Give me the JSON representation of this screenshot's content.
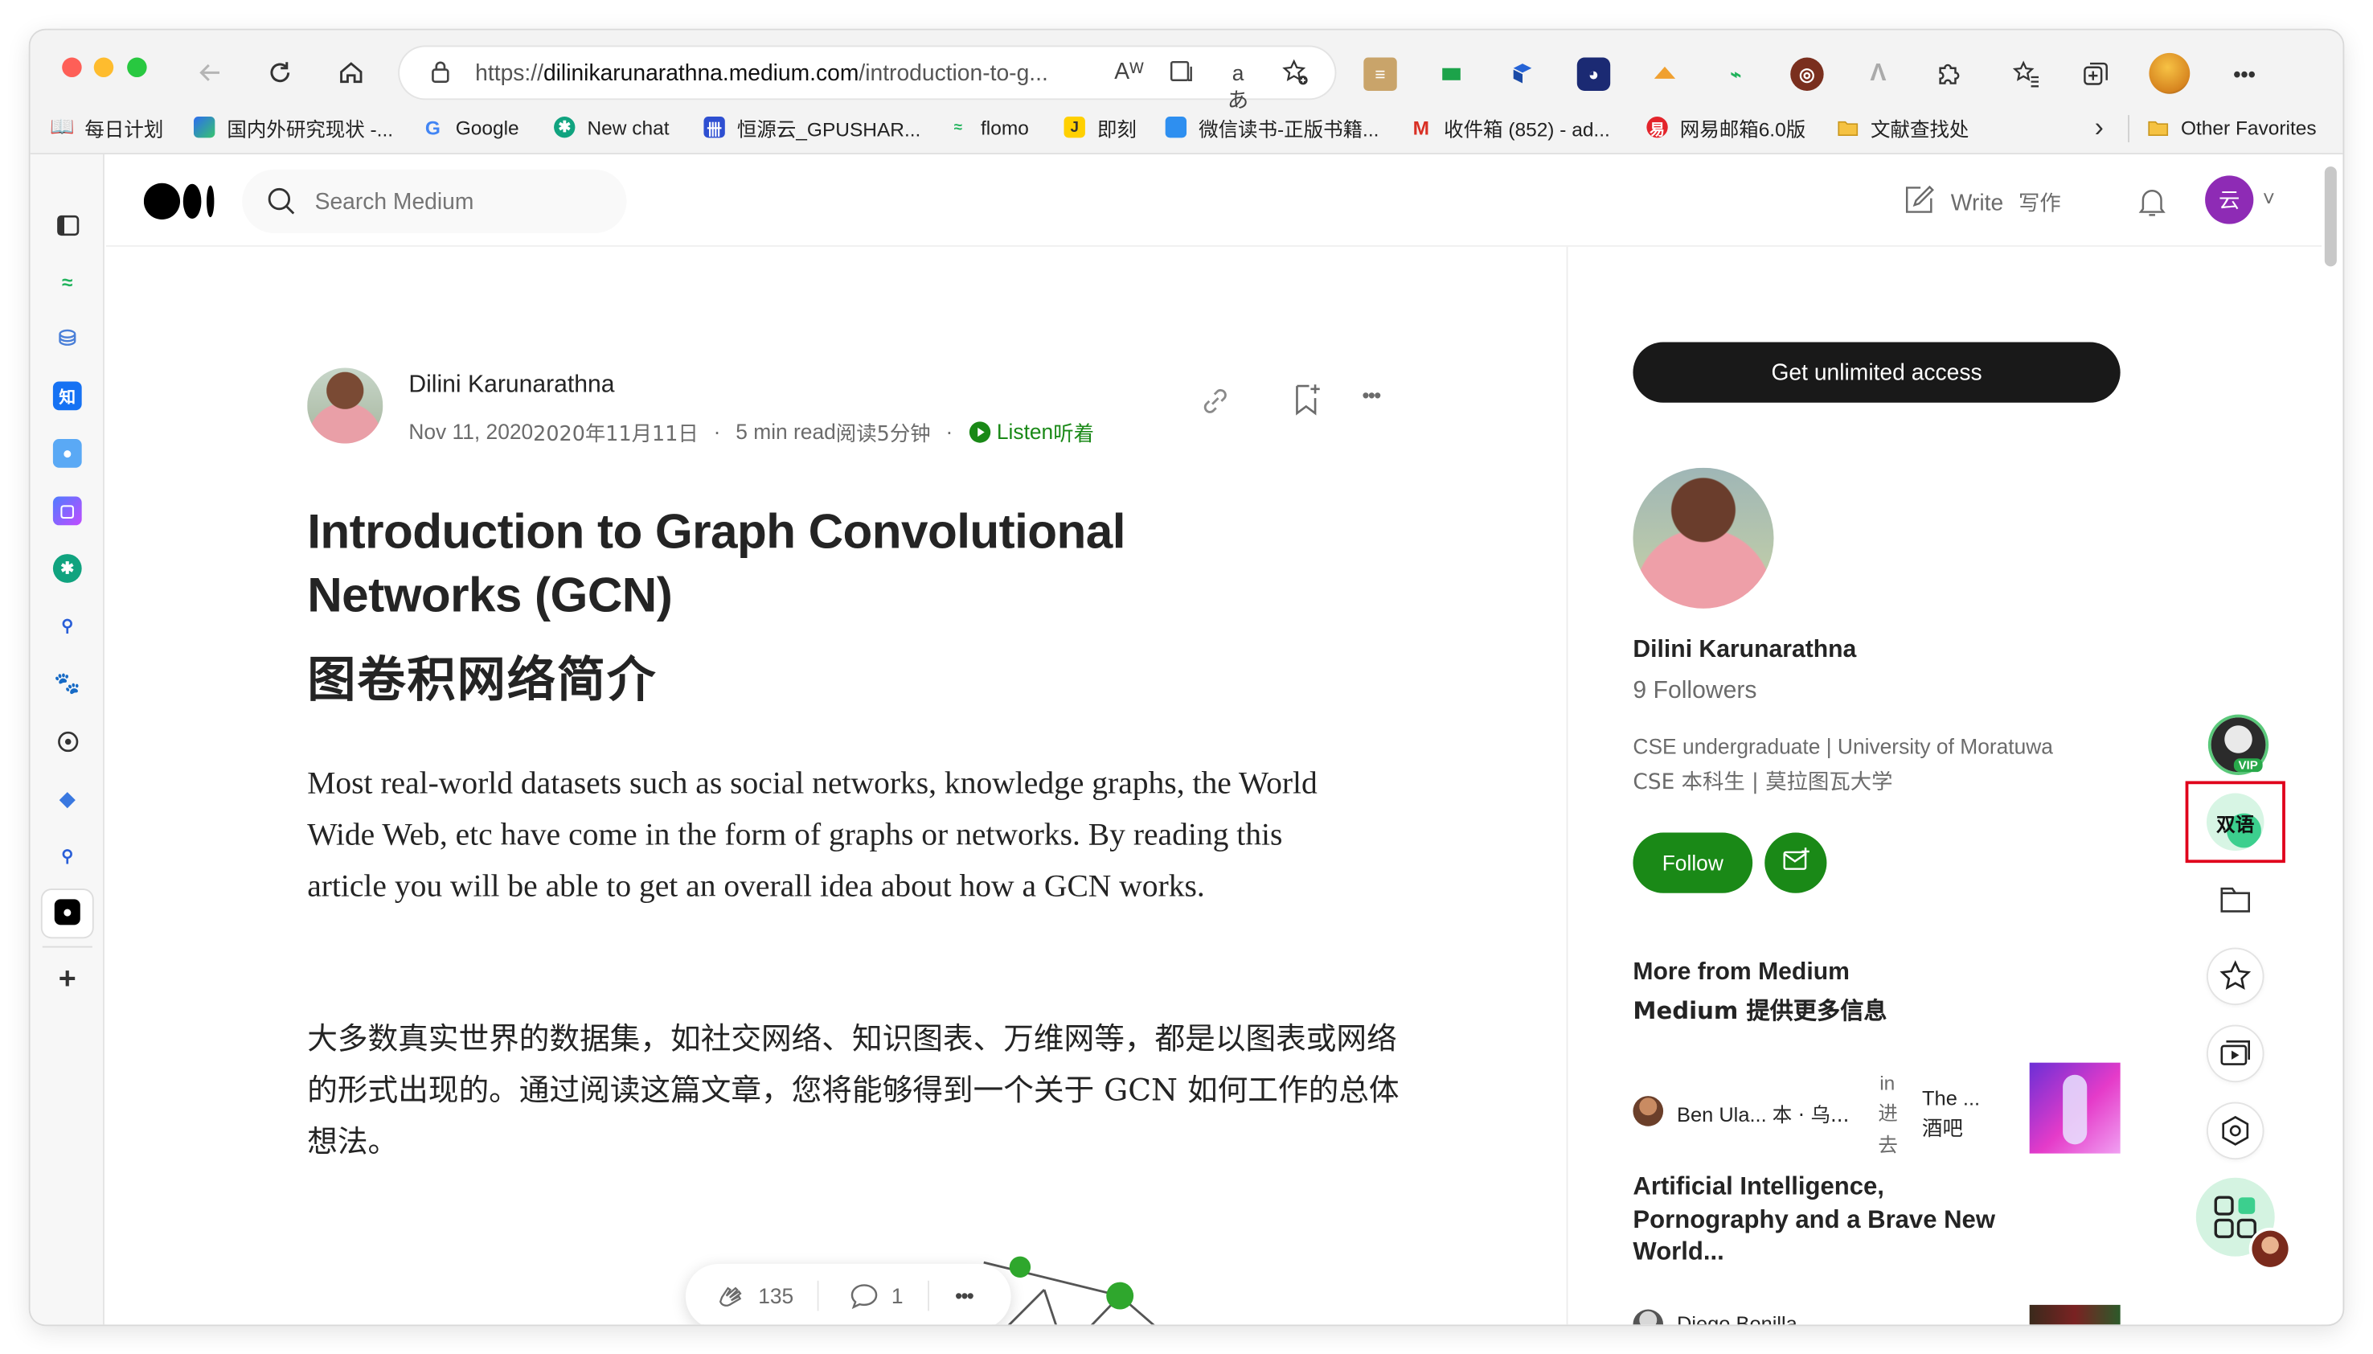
{
  "browser": {
    "url_prefix": "https://",
    "url_domain": "dilinikarunarathna.medium.com",
    "url_path": "/introduction-to-g...",
    "read_aloud_icon": "Aᵂ",
    "translate_icon": "aあ",
    "bookmarks": [
      {
        "label": "每日计划",
        "icon": "book-icon"
      },
      {
        "label": "国内外研究现状 -...",
        "icon": "bookmark-icon"
      },
      {
        "label": "Google",
        "icon": "google-icon"
      },
      {
        "label": "New chat",
        "icon": "chatgpt-icon"
      },
      {
        "label": "恒源云_GPUSHAR...",
        "icon": "gpushare-icon"
      },
      {
        "label": "flomo",
        "icon": "flomo-icon"
      },
      {
        "label": "即刻",
        "icon": "jike-icon"
      },
      {
        "label": "微信读书-正版书籍...",
        "icon": "weread-icon"
      },
      {
        "label": "收件箱 (852) - ad...",
        "icon": "gmail-icon"
      },
      {
        "label": "网易邮箱6.0版",
        "icon": "netease-icon"
      },
      {
        "label": "文献查找处",
        "icon": "folder-icon"
      }
    ],
    "other_favorites": "Other Favorites",
    "more_bookmarks": "›",
    "add_icon": "+"
  },
  "medium": {
    "search_placeholder": "Search Medium",
    "write_label": "Write",
    "write_zh": "写作",
    "avatar_initial": "云",
    "caret": "˅"
  },
  "article": {
    "author": "Dilini Karunarathna",
    "date": "Nov 11, 2020",
    "date_zh": "2020年11月11日",
    "read_time": "5 min read",
    "read_time_zh": "阅读5分钟",
    "listen": "Listen",
    "listen_zh": "听着",
    "title_en": "Introduction to Graph Convolutional Networks (GCN)",
    "title_zh": "图卷积网络简介",
    "para_en": "Most real-world datasets such as social networks, knowledge graphs, the World Wide Web, etc have come in the form of graphs or networks. By reading this article you will be able to get an overall idea about how a GCN works.",
    "para_zh": "大多数真实世界的数据集，如社交网络、知识图表、万维网等，都是以图表或网络的形式出现的。通过阅读这篇文章，您将能够得到一个关于 GCN 如何工作的总体想法。",
    "claps": "135",
    "comments": "1",
    "more": "•••"
  },
  "sidebar": {
    "get_access": "Get unlimited access",
    "author": "Dilini Karunarathna",
    "followers": "9 Followers",
    "bio_en": "CSE undergraduate | University of Moratuwa",
    "bio_zh": "CSE 本科生 | 莫拉图瓦大学",
    "follow": "Follow",
    "more_from": "More from Medium",
    "more_from_zh": "Medium 提供更多信息",
    "card1_author": "Ben Ula...",
    "card1_author_zh": "本 · 乌...",
    "card1_in": "in",
    "card1_in_zh_1": "进",
    "card1_in_zh_2": "去",
    "card1_pub": "The ...",
    "card1_pub_zh": "酒吧",
    "card1_title": "Artificial Intelligence, Pornography and a Brave New World...",
    "card2_author": "Diego Bonilla"
  },
  "ext_panel": {
    "bilingual_label": "双语",
    "vip_label": "VIP"
  },
  "colors": {
    "medium_green": "#1a8917",
    "accent_red": "#e0001b",
    "avatar_purple": "#8e2bb5"
  }
}
